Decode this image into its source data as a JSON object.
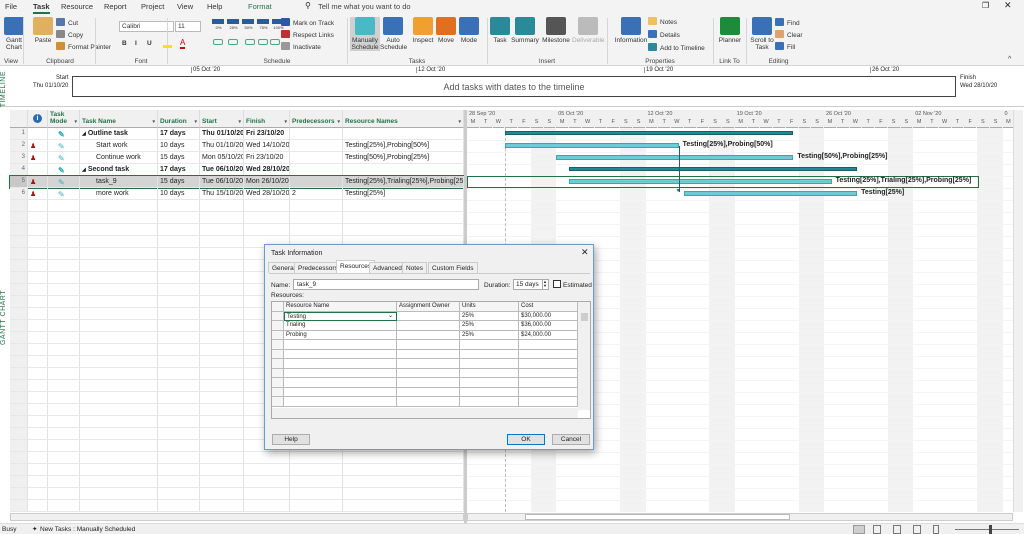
{
  "window": {
    "restore_icon": "restore-icon",
    "close_icon": "close-icon"
  },
  "tabs": [
    {
      "label": "File"
    },
    {
      "label": "Task",
      "active": true
    },
    {
      "label": "Resource"
    },
    {
      "label": "Report"
    },
    {
      "label": "Project"
    },
    {
      "label": "View"
    },
    {
      "label": "Help"
    },
    {
      "label": "Format"
    }
  ],
  "tell_me": "Tell me what you want to do",
  "ribbon": {
    "groups": [
      "View",
      "Clipboard",
      "Font",
      "Schedule",
      "Tasks",
      "Insert",
      "Properties",
      "Link To",
      "Editing"
    ],
    "gantt_chart": "Gantt Chart",
    "paste": "Paste",
    "cut": "Cut",
    "copy": "Copy",
    "format_painter": "Format Painter",
    "font_name": "Calibri",
    "font_size": "11",
    "bold": "B",
    "italic": "I",
    "underline": "U",
    "pct": [
      "0%",
      "25%",
      "50%",
      "75%",
      "100%"
    ],
    "mark_on_track": "Mark on Track",
    "respect_links": "Respect Links",
    "inactivate": "Inactivate",
    "manually_schedule": "Manually Schedule",
    "auto_schedule": "Auto Schedule",
    "inspect": "Inspect",
    "move": "Move",
    "mode": "Mode",
    "task": "Task",
    "summary": "Summary",
    "milestone": "Milestone",
    "deliverable": "Deliverable",
    "information": "Information",
    "notes": "Notes",
    "details": "Details",
    "add_to_timeline": "Add to Timeline",
    "planner": "Planner",
    "scroll_to_task": "Scroll to Task",
    "find": "Find",
    "clear": "Clear",
    "fill": "Fill"
  },
  "timeline": {
    "side_label": "TIMELINE",
    "start_label": "Start",
    "start_date": "Thu 01/10/20",
    "finish_label": "Finish",
    "finish_date": "Wed 28/10/20",
    "placeholder": "Add tasks with dates to the timeline",
    "weeks": [
      "05 Oct '20",
      "12 Oct '20",
      "19 Oct '20",
      "26 Oct '20"
    ]
  },
  "view_label": "GANTT CHART",
  "table": {
    "columns": [
      "Task Mode",
      "Task Name",
      "Duration",
      "Start",
      "Finish",
      "Predecessors",
      "Resource Names"
    ],
    "rows": [
      {
        "id": "1",
        "name": "Outline task",
        "summary": true,
        "duration": "17 days",
        "start": "Thu 01/10/20",
        "finish": "Fri 23/10/20",
        "pred": "",
        "res": "",
        "resicon": false
      },
      {
        "id": "2",
        "name": "Start work",
        "summary": false,
        "duration": "10 days",
        "start": "Thu 01/10/20",
        "finish": "Wed 14/10/20",
        "pred": "",
        "res": "Testing[25%],Probing[50%]",
        "resicon": true
      },
      {
        "id": "3",
        "name": "Continue work",
        "summary": false,
        "duration": "15 days",
        "start": "Mon 05/10/20",
        "finish": "Fri 23/10/20",
        "pred": "",
        "res": "Testing[50%],Probing[25%]",
        "resicon": true
      },
      {
        "id": "4",
        "name": "Second task",
        "summary": true,
        "duration": "17 days",
        "start": "Tue 06/10/20",
        "finish": "Wed 28/10/20",
        "pred": "",
        "res": "",
        "resicon": false
      },
      {
        "id": "5",
        "name": "task_9",
        "summary": false,
        "selected": true,
        "duration": "15 days",
        "start": "Tue 06/10/20",
        "finish": "Mon 26/10/20",
        "pred": "",
        "res": "Testing[25%],Trialing[25%],Probing[25%]",
        "resicon": true
      },
      {
        "id": "6",
        "name": "more work",
        "summary": false,
        "duration": "10 days",
        "start": "Thu 15/10/20",
        "finish": "Wed 28/10/20",
        "pred": "2",
        "res": "Testing[25%]",
        "resicon": true
      }
    ]
  },
  "gantt": {
    "weeks": [
      "28 Sep '20",
      "05 Oct '20",
      "12 Oct '20",
      "19 Oct '20",
      "26 Oct '20",
      "02 Nov '20",
      "0"
    ],
    "day_letters": [
      "M",
      "T",
      "W",
      "T",
      "F",
      "S",
      "S"
    ],
    "timescale_start": "2020-09-28",
    "bars": [
      {
        "task": "1",
        "start": "2020-10-01",
        "finish": "2020-10-23",
        "summary": true,
        "label": ""
      },
      {
        "task": "2",
        "start": "2020-10-01",
        "finish": "2020-10-14",
        "label": "Testing[25%],Probing[50%]"
      },
      {
        "task": "3",
        "start": "2020-10-05",
        "finish": "2020-10-23",
        "label": "Testing[50%],Probing[25%]"
      },
      {
        "task": "4",
        "start": "2020-10-06",
        "finish": "2020-10-28",
        "summary": true,
        "label": ""
      },
      {
        "task": "5",
        "start": "2020-10-06",
        "finish": "2020-10-26",
        "label": "Testing[25%],Trialing[25%],Probing[25%]"
      },
      {
        "task": "6",
        "start": "2020-10-15",
        "finish": "2020-10-28",
        "label": "Testing[25%]"
      }
    ],
    "bar_color": "#6dcbd4"
  },
  "dialog": {
    "title": "Task Information",
    "tabs": [
      "General",
      "Predecessors",
      "Resources",
      "Advanced",
      "Notes",
      "Custom Fields"
    ],
    "active_tab": "Resources",
    "name_label": "Name:",
    "name_value": "task_9",
    "duration_label": "Duration:",
    "duration_value": "15 days",
    "estimated_label": "Estimated",
    "estimated_checked": false,
    "resources_label": "Resources:",
    "columns": [
      "Resource Name",
      "Assignment Owner",
      "Units",
      "Cost"
    ],
    "rows": [
      [
        "Testing",
        "",
        "25%",
        "$30,000.00"
      ],
      [
        "Trialing",
        "",
        "25%",
        "$36,000.00"
      ],
      [
        "Probing",
        "",
        "25%",
        "$24,000.00"
      ]
    ],
    "help": "Help",
    "ok": "OK",
    "cancel": "Cancel"
  },
  "status": {
    "left": "Busy",
    "new_tasks": "New Tasks : Manually Scheduled"
  },
  "accent": "#217346"
}
